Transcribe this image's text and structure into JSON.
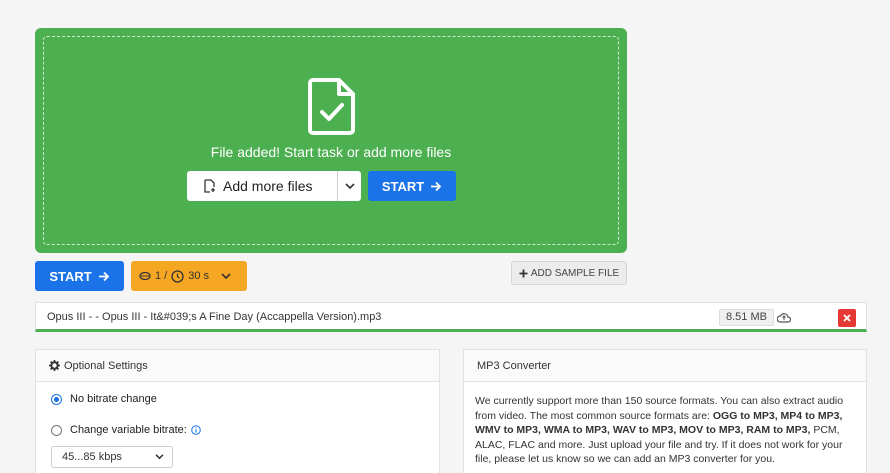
{
  "dropzone": {
    "message": "File added! Start task or add more files",
    "add_more_label": "Add more files",
    "start_label": "START",
    "bg_color": "#4caf50"
  },
  "toolbar": {
    "start_label": "START",
    "limits_count": "1 /",
    "limits_time": "30 s",
    "sample_label": "ADD SAMPLE FILE"
  },
  "file": {
    "name": "Opus III - - Opus III - It&#039;s A Fine Day (Accappella Version).mp3",
    "size": "8.51 MB"
  },
  "settings": {
    "title": "Optional Settings",
    "options": [
      {
        "label": "No bitrate change",
        "selected": true
      },
      {
        "label": "Change variable bitrate:",
        "selected": false
      }
    ],
    "bitrate_value": "45...85 kbps"
  },
  "info": {
    "title": "MP3 Converter",
    "text_1": "We currently support more than 150 source formats. You can also extract audio from video. The most common source formats are: ",
    "formats": "OGG to MP3, MP4 to MP3, WMV to MP3, WMA to MP3, WAV to MP3, MOV to MP3, RAM to MP3,",
    "text_2": " PCM, ALAC, FLAC and more. Just upload your file and try. If it does not work for your file, please let us know so we can add an MP3 converter for you."
  },
  "icons": [
    "file-check-icon",
    "file-add-icon",
    "chevron-down-icon",
    "arrow-right-icon",
    "coin-icon",
    "clock-icon",
    "plus-icon",
    "cloud-upload-icon",
    "close-icon",
    "gear-icon",
    "info-icon"
  ],
  "colors": {
    "primary": "#1a73e8",
    "success": "#4caf50",
    "warning": "#f5a623",
    "danger": "#e53935"
  }
}
